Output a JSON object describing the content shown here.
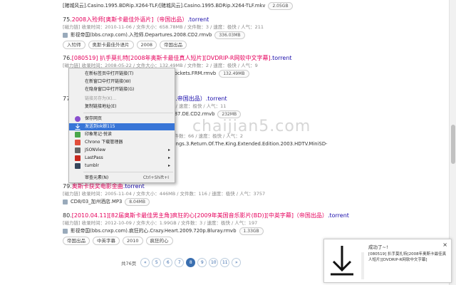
{
  "entries": [
    {
      "file": "[赌城风云].Casino.1995.BDRip.X264-TLF/[赌城风云].Casino.1995.BDRip.X264-TLF.mkv",
      "size": "2.05GB"
    },
    {
      "num": "75.",
      "title_hl": "2008入殓师[奥斯卡最佳外语片]（帝国出品）",
      "title_rest": ".torrent",
      "meta": "[磁力链] 收录时间：2010-11-06 / 文件大小：658.78MB / 文件数：3 / 速度：极快 / 人气：211",
      "file": "影视帝国(bbs.cnxp.com).入殓师.Departures.2008.CD2.rmvb",
      "size": "336.03MB",
      "tags": [
        "入殓师",
        "奥斯卡最佳外语片",
        "2008",
        "帝国出品"
      ]
    },
    {
      "num": "76.",
      "title_hl": "[080519] 扒手莫扎特[2008年奥斯卡最佳真人短片][DVDRIP-R网软中文字幕]",
      "title_rest": ".torrent",
      "meta": "[磁力链] 收录时间：2008-05-22 / 文件大小：132.49MB / 文件数：2 / 速度：极快 / 人气：9",
      "file": "…ockets.FRM.rmvb",
      "size": "132.49MB"
    },
    {
      "num": "77.",
      "title_rest": "…帝国出品）.torrent",
      "meta": "… / 速度：极快 / 人气：11",
      "file": "…87.DE.CD2.rmvb",
      "size": "232MB"
    },
    {
      "num": "78.",
      "title_rest": "…",
      "meta": "…件数：66 / 速度：极快 / 人气：2",
      "file": "…ings.3.Return.Of.The.King.Extended.Edition.2003.HDTV.MiniSD-"
    },
    {
      "num": "79.",
      "title_hl": "奥斯卡获奖电影金曲",
      "title_rest": ".torrent",
      "meta": "[磁力链] 收录时间：2005-11-04 / 文件大小：446MB / 文件数：116 / 速度：极快 / 人气：3757",
      "file": "CD8/03_加州酒店.MP3",
      "size": "8.04MB"
    },
    {
      "num": "80.",
      "title_hl": "[2010.04.11][82届奥斯卡最佳男主角]疯狂的心[2009年美国音乐影片(BD)][中英字幕]（帝国出品）",
      "title_rest": ".torrent",
      "meta": "[磁力链] 收录时间：2012-10-09 / 文件大小：1.99GB / 文件数：3 / 速度：极快 / 人气：197",
      "file": "影视帝国(bbs.cnxp.com).疯狂的心.Crazy.Heart.2009.720p.Bluray.rmvb",
      "size": "1.33GB",
      "tags": [
        "帝国出品",
        "中英字幕",
        "2010",
        "疯狂的心"
      ]
    }
  ],
  "context_menu": {
    "items": [
      {
        "label": "在新标签页中打开链接(T)"
      },
      {
        "label": "在新窗口中打开链接(W)"
      },
      {
        "label": "在隐身窗口中打开链接(G)"
      },
      {
        "label": "链接另存为(K)...",
        "disabled": true
      },
      {
        "label": "复制链接地址(E)"
      },
      {
        "label": "保存网页",
        "icon": "cloud-icon",
        "color": "#8a4fcf"
      },
      {
        "label": "发送到ok娘115",
        "icon": "download-icon",
        "color": "#2a6bd1",
        "active": true
      },
      {
        "label": "印象笔记·悦读",
        "icon": "evernote-icon",
        "color": "#4aa64a"
      },
      {
        "label": "Chrono 下载管理器",
        "icon": "chrono-icon",
        "color": "#e14f3b"
      },
      {
        "label": "JSONView",
        "icon": "json-icon",
        "color": "#666666",
        "submenu": true
      },
      {
        "label": "LastPass",
        "icon": "lastpass-icon",
        "color": "#c8281e",
        "submenu": true
      },
      {
        "label": "tumblr",
        "icon": "tumblr-icon",
        "color": "#35465c",
        "submenu": true
      },
      {
        "label": "审查元素(N)",
        "shortcut": "Ctrl+Shift+I"
      }
    ]
  },
  "pager": {
    "total": "共76页",
    "pages": [
      "«",
      "5",
      "6",
      "7",
      "8",
      "9",
      "10",
      "11",
      "»"
    ],
    "current": "8"
  },
  "toast": {
    "title": "成功了~!",
    "message": "[080519] 扒手莫扎特[2008年奥斯卡最佳真人短片][DVDRIP-R网软中文字幕]",
    "close": "×"
  },
  "watermark": "chaijian5.com",
  "colors": {
    "link": "#1a0dab",
    "highlight": "#e6005c",
    "menu_active": "#3875d7"
  }
}
